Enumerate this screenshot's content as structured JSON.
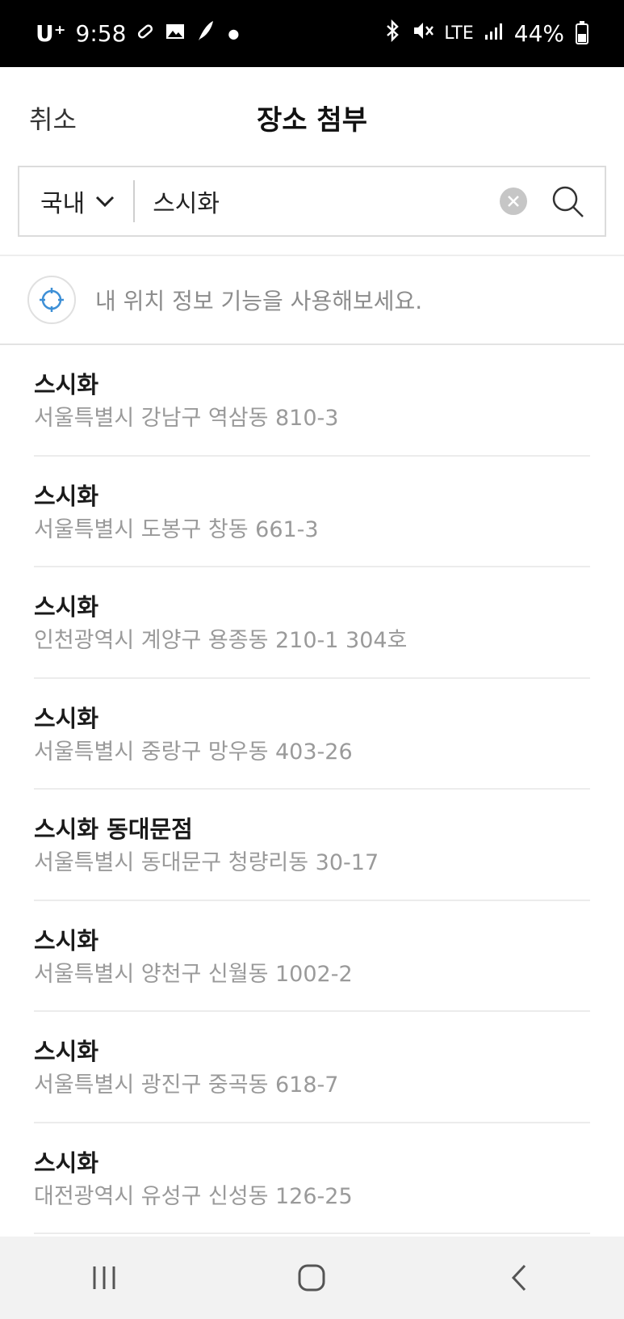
{
  "status_bar": {
    "carrier": "U⁺",
    "time": "9:58",
    "network": "LTE",
    "battery": "44%"
  },
  "header": {
    "cancel_label": "취소",
    "title": "장소 첨부"
  },
  "search": {
    "region_label": "국내",
    "query": "스시화"
  },
  "location_prompt": "내 위치 정보 기능을 사용해보세요.",
  "results": [
    {
      "name": "스시화",
      "address": "서울특별시 강남구 역삼동 810-3"
    },
    {
      "name": "스시화",
      "address": "서울특별시 도봉구 창동 661-3"
    },
    {
      "name": "스시화",
      "address": "인천광역시 계양구 용종동 210-1 304호"
    },
    {
      "name": "스시화",
      "address": "서울특별시 중랑구 망우동 403-26"
    },
    {
      "name": "스시화 동대문점",
      "address": "서울특별시 동대문구 청량리동 30-17"
    },
    {
      "name": "스시화",
      "address": "서울특별시 양천구 신월동 1002-2"
    },
    {
      "name": "스시화",
      "address": "서울특별시 광진구 중곡동 618-7"
    },
    {
      "name": "스시화",
      "address": "대전광역시 유성구 신성동 126-25"
    }
  ],
  "icons": {
    "region_toggle": "chevron-down-icon",
    "clear": "clear-icon",
    "search": "search-icon",
    "location": "crosshair-icon",
    "nav_recent": "recent-apps-icon",
    "nav_home": "home-icon",
    "nav_back": "back-icon"
  },
  "colors": {
    "location_accent": "#3d8fd6",
    "muted_text": "#9a9a9a"
  }
}
